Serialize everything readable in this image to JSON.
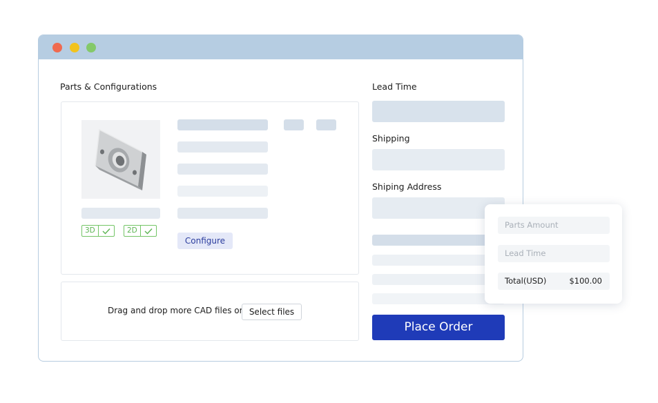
{
  "parts": {
    "title": "Parts & Configurations",
    "badges": [
      "3D",
      "2D"
    ],
    "configure_label": "Configure",
    "part_image": "cad-part-3d-render"
  },
  "upload": {
    "prompt": "Drag and drop more CAD files or",
    "select_label": "Select files"
  },
  "order": {
    "lead_time_label": "Lead Time",
    "shipping_label": "Shipping",
    "address_label": "Shiping Address",
    "place_order_label": "Place Order"
  },
  "summary": {
    "parts_amount_placeholder": "Parts Amount",
    "lead_time_placeholder": "Lead Time",
    "total_label": "Total(USD)",
    "total_value": "$100.00"
  },
  "window": {
    "controls": [
      "close",
      "minimize",
      "maximize"
    ]
  },
  "colors": {
    "titlebar": "#b6cde2",
    "accent": "#1f3bb8",
    "check_green": "#72c465",
    "close": "#f06a4f",
    "minimize": "#f2c31d",
    "maximize": "#84c96a"
  }
}
